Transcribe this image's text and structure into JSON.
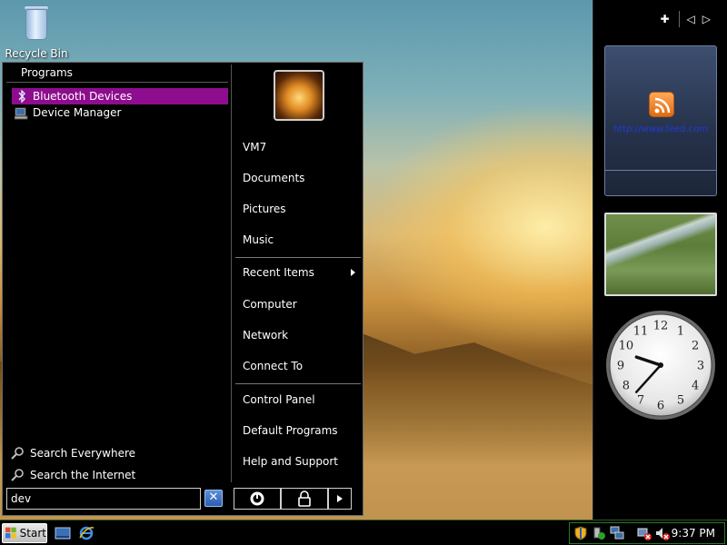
{
  "desktop": {
    "recycle_bin_label": "Recycle Bin"
  },
  "start_menu": {
    "programs_header": "Programs",
    "programs": [
      {
        "label": "Bluetooth Devices",
        "icon": "bluetooth-icon",
        "selected": true
      },
      {
        "label": "Device Manager",
        "icon": "device-manager-icon",
        "selected": false
      }
    ],
    "search_links": [
      {
        "label": "Search Everywhere",
        "icon": "magnifier-icon"
      },
      {
        "label": "Search the Internet",
        "icon": "magnifier-icon"
      }
    ],
    "right_items": [
      {
        "label": "VM7"
      },
      {
        "label": "Documents"
      },
      {
        "label": "Pictures"
      },
      {
        "label": "Music"
      },
      {
        "label": "Recent Items",
        "submenu": true
      },
      {
        "label": "Computer"
      },
      {
        "label": "Network"
      },
      {
        "label": "Connect To"
      },
      {
        "label": "Control Panel"
      },
      {
        "label": "Default Programs"
      },
      {
        "label": "Help and Support"
      }
    ],
    "search_value": "dev",
    "clear_label": "✕"
  },
  "sidebar": {
    "controls": [
      "✚",
      "◁",
      "▷"
    ],
    "feed_link": "http://www.feed.com",
    "clock": {
      "hour": 9,
      "minute": 37
    }
  },
  "taskbar": {
    "start_label": "Start",
    "time": "9:37 PM"
  },
  "colors": {
    "selected_highlight": "#8e0d8e",
    "menu_background": "#000000",
    "taskbar_border": "#2a7a2a"
  }
}
